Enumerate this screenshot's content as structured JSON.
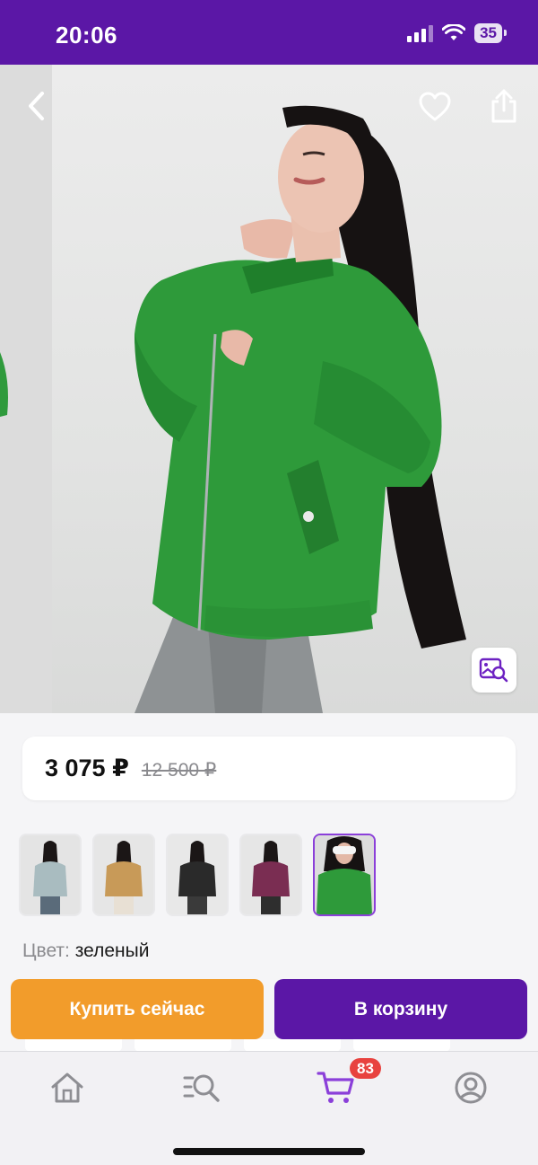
{
  "status_bar": {
    "time": "20:06",
    "battery": "35"
  },
  "hero": {
    "back_icon": "chevron-left-icon",
    "favorite_icon": "heart-icon",
    "share_icon": "share-icon",
    "visual_search_icon": "image-search-icon"
  },
  "price": {
    "current": "3 075 ₽",
    "old": "12 500 ₽"
  },
  "variants": {
    "thumbnails": [
      {
        "color": "#a9bcc0",
        "selected": false
      },
      {
        "color": "#c89a58",
        "selected": false
      },
      {
        "color": "#2a2a2a",
        "selected": false
      },
      {
        "color": "#7a2d52",
        "selected": false
      },
      {
        "color": "#2e9a3a",
        "selected": true
      }
    ]
  },
  "color": {
    "label": "Цвет:",
    "value": "зеленый"
  },
  "actions": {
    "buy_now": "Купить сейчас",
    "add_to_cart": "В корзину"
  },
  "tab_bar": {
    "items": [
      {
        "icon": "home-icon"
      },
      {
        "icon": "catalog-search-icon"
      },
      {
        "icon": "cart-icon",
        "badge": "83"
      },
      {
        "icon": "profile-icon"
      }
    ]
  },
  "colors": {
    "brand": "#5b17a6",
    "accent_orange": "#f29c2b",
    "badge_red": "#e8423f",
    "selected_border": "#8b3fd9"
  }
}
